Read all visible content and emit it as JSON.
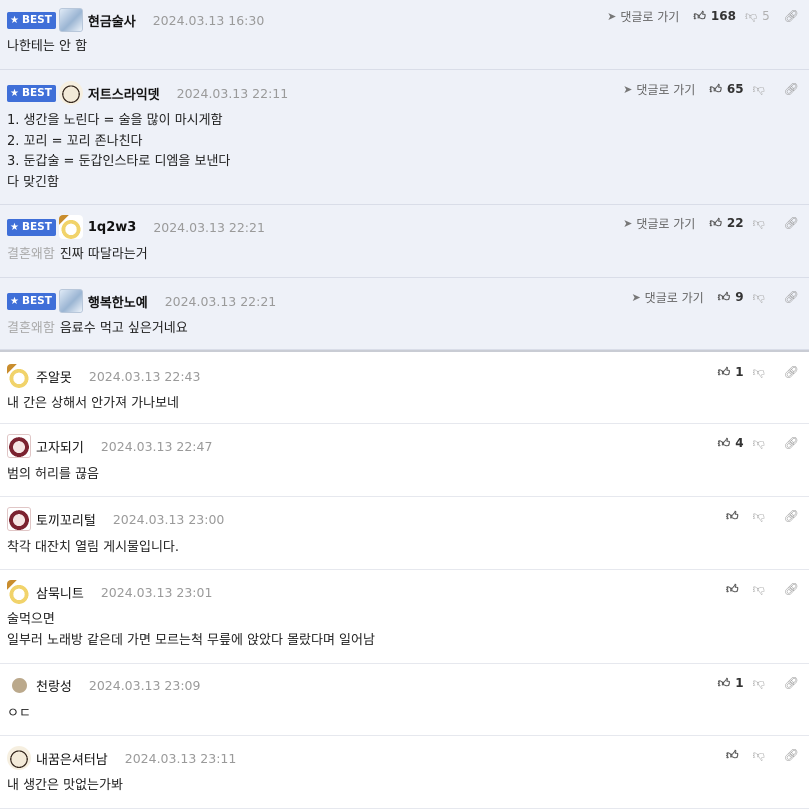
{
  "best_label": "BEST",
  "reply_label": "댓글로 가기",
  "comments": [
    {
      "nick": "현금술사",
      "date": "2024.03.13 16:30",
      "likes": "168",
      "dislikes": "5",
      "tag": "",
      "lines": [
        "나한테는 안 함"
      ]
    },
    {
      "nick": "저트스라익뎃",
      "date": "2024.03.13 22:11",
      "likes": "65",
      "dislikes": "",
      "tag": "",
      "lines": [
        "1. 생간을 노린다 = 술을 많이 마시게함",
        "2. 꼬리 = 꼬리 존나친다",
        "3. 둔갑술 = 둔갑인스타로 디엠을 보낸다",
        "다 맞긴함"
      ]
    },
    {
      "nick": "1q2w3",
      "date": "2024.03.13 22:21",
      "likes": "22",
      "dislikes": "",
      "tag": "결혼왜함",
      "lines": [
        "진짜 따달라는거"
      ]
    },
    {
      "nick": "행복한노예",
      "date": "2024.03.13 22:21",
      "likes": "9",
      "dislikes": "",
      "tag": "결혼왜함",
      "lines": [
        "음료수 먹고 싶은거네요"
      ]
    },
    {
      "nick": "주알못",
      "date": "2024.03.13 22:43",
      "likes": "1",
      "dislikes": "",
      "tag": "",
      "lines": [
        "내 간은 상해서 안가져 가나보네"
      ]
    },
    {
      "nick": "고자되기",
      "date": "2024.03.13 22:47",
      "likes": "4",
      "dislikes": "",
      "tag": "",
      "lines": [
        "범의 허리를 끊음"
      ]
    },
    {
      "nick": "토끼꼬리털",
      "date": "2024.03.13 23:00",
      "likes": "",
      "dislikes": "",
      "tag": "",
      "lines": [
        "착각 대잔치 열림 게시물입니다."
      ]
    },
    {
      "nick": "삼묵니트",
      "date": "2024.03.13 23:01",
      "likes": "",
      "dislikes": "",
      "tag": "",
      "lines": [
        "술먹으면",
        "일부러 노래방 같은데 가면 모르는척 무릎에 앉았다 몰랐다며 일어남"
      ]
    },
    {
      "nick": "천랑성",
      "date": "2024.03.13 23:09",
      "likes": "1",
      "dislikes": "",
      "tag": "",
      "lines": [
        "ㅇㄷ"
      ]
    },
    {
      "nick": "내꿈은셔터남",
      "date": "2024.03.13 23:11",
      "likes": "",
      "dislikes": "",
      "tag": "",
      "lines": [
        "내 생간은 맛없는가봐"
      ]
    }
  ],
  "icons": {
    "like": "thumbs-up-icon",
    "dislike": "thumbs-down-icon",
    "share": "link-icon",
    "reply": "send-arrow-icon",
    "star": "star-icon"
  }
}
